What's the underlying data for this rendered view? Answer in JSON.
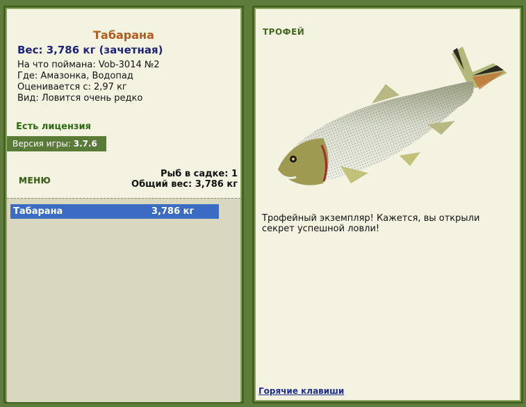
{
  "fish": {
    "name": "Табарана",
    "weight_line": "Вес: 3,786 кг (зачетная)",
    "bait": "На что поймана: Vob-3014 №2",
    "place": "Где: Амазонка, Водопад",
    "price": "Оценивается с: 2,97 кг",
    "kind": "Вид: Ловится очень редко"
  },
  "license": "Есть лицензия",
  "version": {
    "label": "Версия игры:",
    "value": "3.7.6"
  },
  "menu": "МЕНЮ",
  "keep": {
    "count": "Рыб в садке: 1",
    "total": "Общий вес: 3,786 кг",
    "items": [
      {
        "name": "Табарана",
        "weight": "3,786 кг"
      }
    ]
  },
  "trophy": {
    "label": "ТРОФЕЙ",
    "text": "Трофейный экземпляр! Кажется, вы открыли секрет успешной ловли!"
  },
  "hotkeys": "Горячие клавиши",
  "colors": {
    "background": "#5e7d3c",
    "panel": "#f4f3e2",
    "selected_row": "#3a6cc4",
    "title": "#b25b1b",
    "weight": "#1d2475"
  }
}
